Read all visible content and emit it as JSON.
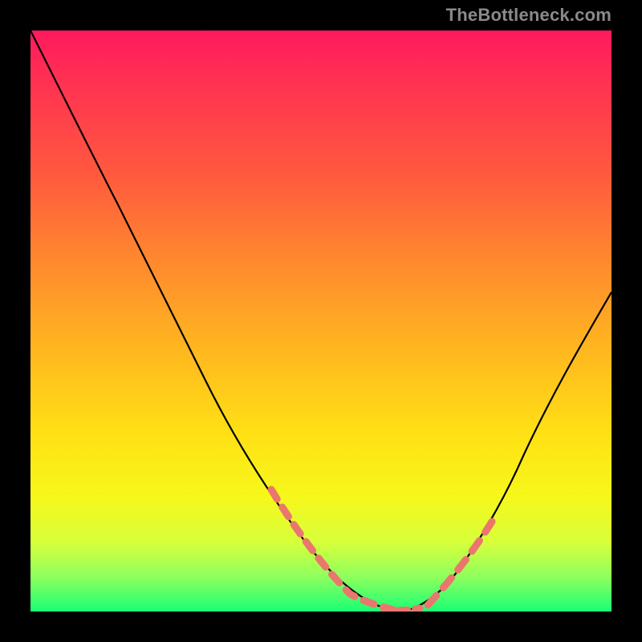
{
  "watermark": "TheBottleneck.com",
  "chart_data": {
    "type": "line",
    "title": "",
    "xlabel": "",
    "ylabel": "",
    "xlim": [
      0,
      100
    ],
    "ylim": [
      0,
      100
    ],
    "grid": false,
    "legend": false,
    "background": "red-orange-yellow-green vertical gradient",
    "annotations": [
      "TheBottleneck.com"
    ],
    "series": [
      {
        "name": "curve",
        "color": "#000000",
        "style": "solid",
        "x": [
          0,
          5,
          10,
          15,
          20,
          25,
          30,
          35,
          40,
          45,
          50,
          55,
          60,
          63,
          67,
          72,
          78,
          85,
          92,
          100
        ],
        "y": [
          100,
          90,
          80,
          70,
          60,
          50,
          40,
          30,
          22,
          15,
          8,
          3,
          1,
          0,
          1,
          5,
          14,
          27,
          40,
          55
        ]
      },
      {
        "name": "highlight-dash-left",
        "color": "#e9756b",
        "style": "dashed",
        "x": [
          40,
          45,
          50,
          55,
          60,
          63
        ],
        "y": [
          22,
          15,
          8,
          3,
          1,
          0
        ]
      },
      {
        "name": "highlight-dash-right",
        "color": "#e9756b",
        "style": "dashed",
        "x": [
          63,
          67,
          72,
          78
        ],
        "y": [
          0,
          1,
          5,
          14
        ]
      }
    ]
  }
}
